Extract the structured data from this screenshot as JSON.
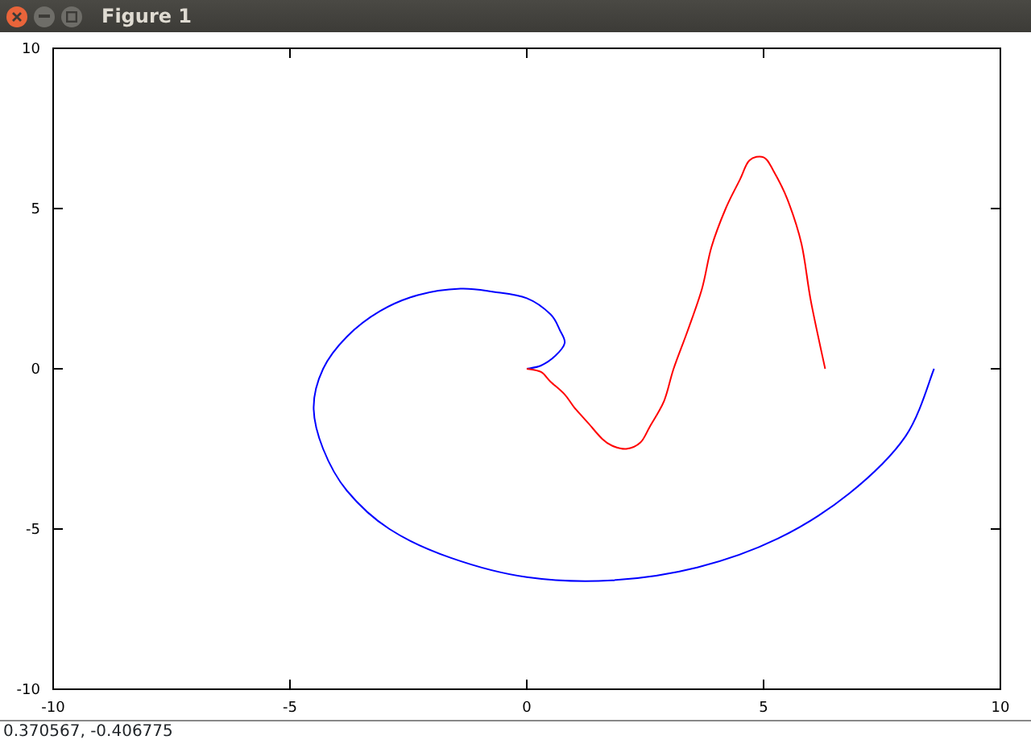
{
  "window": {
    "title": "Figure 1"
  },
  "figure": {
    "chart_data": {
      "type": "line",
      "xlim": [
        -10,
        10
      ],
      "ylim": [
        -10,
        10
      ],
      "xticks": [
        -10,
        -5,
        0,
        5,
        10
      ],
      "yticks": [
        -10,
        -5,
        0,
        5,
        10
      ],
      "series": [
        {
          "color": "#0000ff",
          "x": [
            0,
            0.3,
            0.6,
            0.8,
            0.7,
            0.5,
            0,
            -0.7,
            -1.4,
            -2.3,
            -3.1,
            -3.8,
            -4.3,
            -4.5,
            -4.3,
            -3.8,
            -2.9,
            -1.6,
            0,
            1.8,
            3.6,
            5.3,
            6.8,
            8,
            8.6
          ],
          "values": [
            0,
            0.1,
            0.4,
            0.8,
            1.2,
            1.7,
            2.2,
            2.4,
            2.5,
            2.3,
            1.8,
            1,
            0,
            -1.2,
            -2.5,
            -3.8,
            -5,
            -5.9,
            -6.5,
            -6.6,
            -6.2,
            -5.3,
            -3.9,
            -2.1,
            0
          ]
        },
        {
          "color": "#ff0000",
          "x": [
            0,
            0.3,
            0.5,
            0.8,
            1,
            1.3,
            1.6,
            1.8,
            2.1,
            2.4,
            2.6,
            2.9,
            3.1,
            3.4,
            3.7,
            3.9,
            4.2,
            4.5,
            4.7,
            5,
            5.2,
            5.5,
            5.8,
            6,
            6.3
          ],
          "values": [
            0,
            -0.1,
            -0.4,
            -0.8,
            -1.2,
            -1.7,
            -2.2,
            -2.4,
            -2.5,
            -2.3,
            -1.8,
            -1,
            0,
            1.2,
            2.5,
            3.8,
            5,
            5.9,
            6.5,
            6.6,
            6.2,
            5.3,
            3.9,
            2.1,
            0
          ]
        }
      ]
    }
  },
  "status_bar": {
    "text": "0.370567, -0.406775"
  }
}
